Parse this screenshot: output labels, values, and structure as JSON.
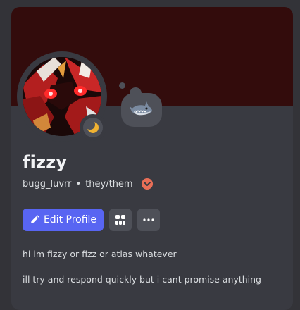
{
  "profile": {
    "display_name": "fizzy",
    "username": "bugg_luvrr",
    "separator": "•",
    "pronouns": "they/them",
    "status": "idle",
    "badge_icon": "nitro-chevron-icon",
    "avatar_icon": "avatar-image",
    "custom_status_emoji": "shark-emoji"
  },
  "actions": {
    "edit_label": "Edit Profile",
    "widgets_icon": "widgets-icon",
    "more_icon": "more-options-icon"
  },
  "bio": {
    "lines": [
      "hi im fizzy or fizz or atlas whatever",
      "ill try and respond quickly but i cant promise anything"
    ]
  },
  "colors": {
    "banner": "#330c0c",
    "card": "#393a41",
    "accent": "#5865f2",
    "idle_moon": "#f0b232",
    "badge": "#e86e57"
  }
}
